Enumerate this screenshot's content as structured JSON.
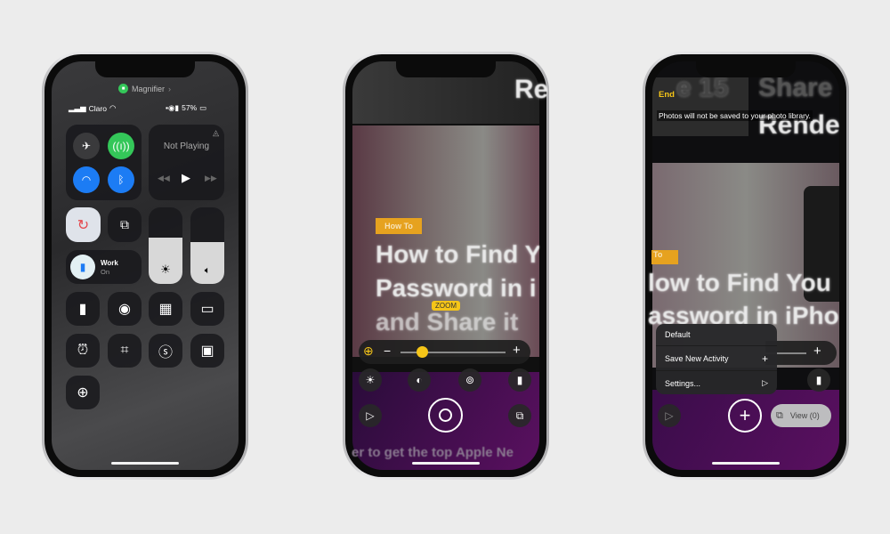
{
  "phone1": {
    "active_app": "Magnifier",
    "carrier": "Claro",
    "battery": "57%",
    "media": {
      "title": "Not Playing"
    },
    "focus": {
      "label": "Work",
      "state": "On"
    },
    "brightness_level": 0.6,
    "volume_level": 0.55,
    "colors": {
      "cellular": "#34c759",
      "wifi": "#1c7cf4",
      "bluetooth": "#1c7cf4",
      "rotation_lock": "#e5484d"
    }
  },
  "phone2": {
    "bg_text": {
      "top": "Re",
      "tag": "How To",
      "line1": "How to Find Y",
      "line2": "Password in i",
      "line3": "and Share it",
      "bottom": "er to get the top Apple Ne"
    },
    "zoom_label": "ZOOM",
    "zoom_minus": "−",
    "zoom_plus": "+",
    "zoom_level": 0.2,
    "accent": "#f5c518"
  },
  "phone3": {
    "end_label": "End",
    "banner": "Photos will not be saved to your photo library.",
    "bg_text": {
      "top1": "e 15",
      "top2": "Share",
      "top3": "Rende",
      "tag": "To",
      "line1": "low to Find You",
      "line2": "assword in iPho"
    },
    "menu": [
      {
        "label": "Default",
        "icon": ""
      },
      {
        "label": "Save New Activity",
        "icon": "+"
      },
      {
        "label": "Settings...",
        "icon": "▷"
      }
    ],
    "zoom_plus": "+",
    "view_label": "View (0)"
  }
}
